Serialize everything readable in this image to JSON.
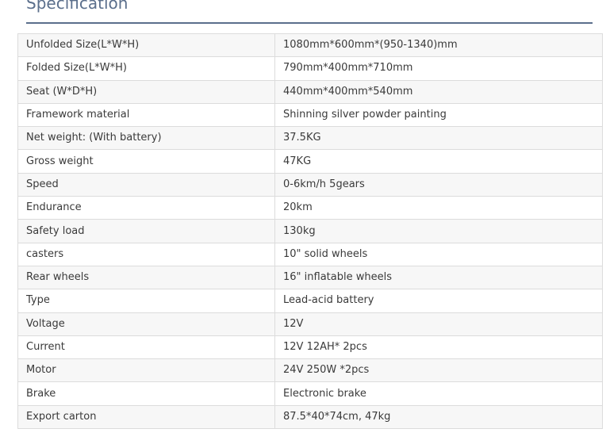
{
  "page_title": "Specification",
  "specs": [
    {
      "label": "Unfolded Size(L*W*H)",
      "value": "1080mm*600mm*(950-1340)mm"
    },
    {
      "label": "Folded Size(L*W*H)",
      "value": "790mm*400mm*710mm"
    },
    {
      "label": "Seat (W*D*H)",
      "value": "440mm*400mm*540mm"
    },
    {
      "label": "Framework material",
      "value": "Shinning silver powder painting"
    },
    {
      "label": "Net weight: (With battery)",
      "value": "37.5KG"
    },
    {
      "label": "Gross weight",
      "value": "47KG"
    },
    {
      "label": "Speed",
      "value": "0-6km/h 5gears"
    },
    {
      "label": "Endurance",
      "value": "20km"
    },
    {
      "label": "Safety load",
      "value": "130kg"
    },
    {
      "label": "casters",
      "value": "10\" solid wheels"
    },
    {
      "label": "Rear wheels",
      "value": "16\" inflatable wheels"
    },
    {
      "label": "Type",
      "value": "Lead-acid battery"
    },
    {
      "label": "Voltage",
      "value": "12V"
    },
    {
      "label": "Current",
      "value": "12V 12AH* 2pcs"
    },
    {
      "label": "Motor",
      "value": "24V 250W *2pcs"
    },
    {
      "label": "Brake",
      "value": "Electronic brake"
    },
    {
      "label": "Export carton",
      "value": "87.5*40*74cm, 47kg"
    }
  ]
}
